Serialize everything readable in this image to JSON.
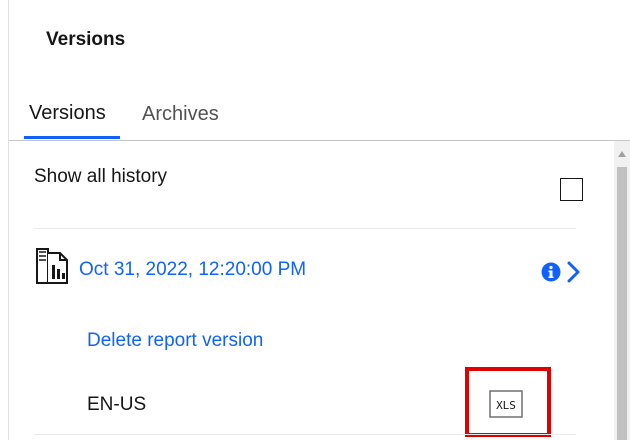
{
  "panel": {
    "title": "Versions"
  },
  "tabs": [
    {
      "label": "Versions",
      "selected": true
    },
    {
      "label": "Archives",
      "selected": false
    }
  ],
  "history": {
    "label": "Show all history",
    "checked": false
  },
  "version_entry": {
    "icon": "report-icon",
    "timestamp": "Oct 31, 2022, 12:20:00 PM",
    "info_icon": "info-icon",
    "expand_icon": "chevron-right-icon",
    "delete_label": "Delete report version",
    "locale": "EN-US",
    "output_format": "XLS",
    "output_icon": "xls-file-icon"
  },
  "colors": {
    "link": "#0f62fe",
    "tab_indicator": "#0f62fe",
    "highlight": "#e00000",
    "text": "#161616"
  }
}
